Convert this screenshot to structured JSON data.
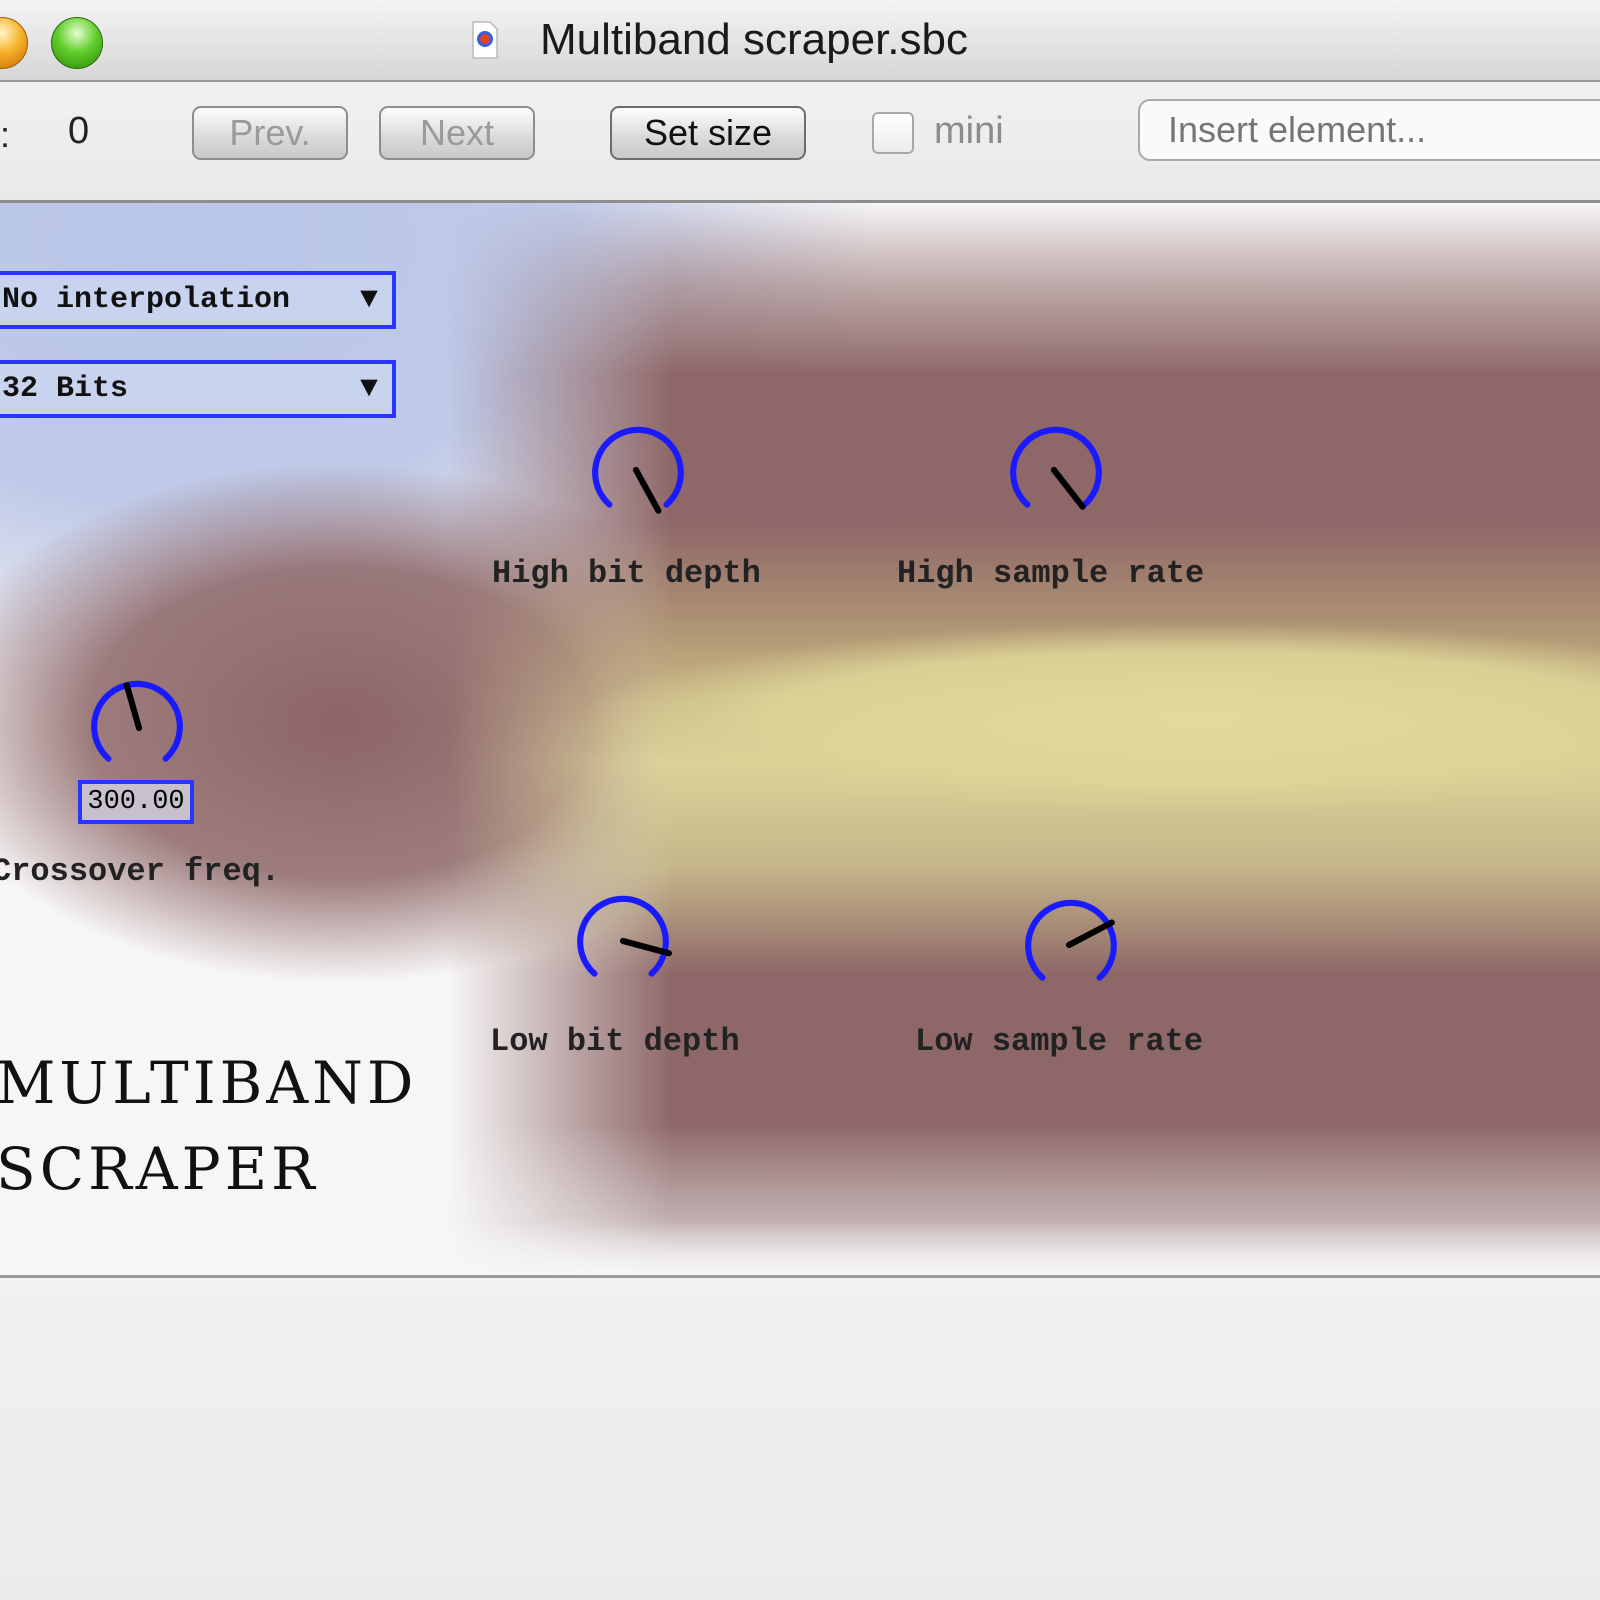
{
  "window": {
    "title": "Multiband scraper.sbc"
  },
  "toolbar": {
    "colon": ":",
    "count": "0",
    "prev_label": "Prev.",
    "next_label": "Next",
    "set_size_label": "Set size",
    "mini_label": "mini",
    "mini_checked": false,
    "insert_placeholder": "Insert element..."
  },
  "canvas": {
    "interpolation_menu": {
      "value": "No interpolation",
      "arrow": "▼"
    },
    "bits_menu": {
      "value": "32 Bits",
      "arrow": "▼"
    },
    "knobs": [
      {
        "id": "crossover",
        "label": "Crossover freq.",
        "value_display": "300.00"
      },
      {
        "id": "high_bit_depth",
        "label": "High bit depth"
      },
      {
        "id": "high_sample_rate",
        "label": "High sample rate"
      },
      {
        "id": "low_bit_depth",
        "label": "Low bit depth"
      },
      {
        "id": "low_sample_rate",
        "label": "Low sample rate"
      }
    ],
    "logo_line1": "MULTIBAND",
    "logo_line2": "SCRAPER"
  },
  "colors": {
    "knob_blue": "#1a1aff",
    "menu_border": "#2a35ff",
    "menu_fill": "#c8d4ef",
    "mauve": "#8e6768",
    "yellow": "#e2da9a"
  }
}
